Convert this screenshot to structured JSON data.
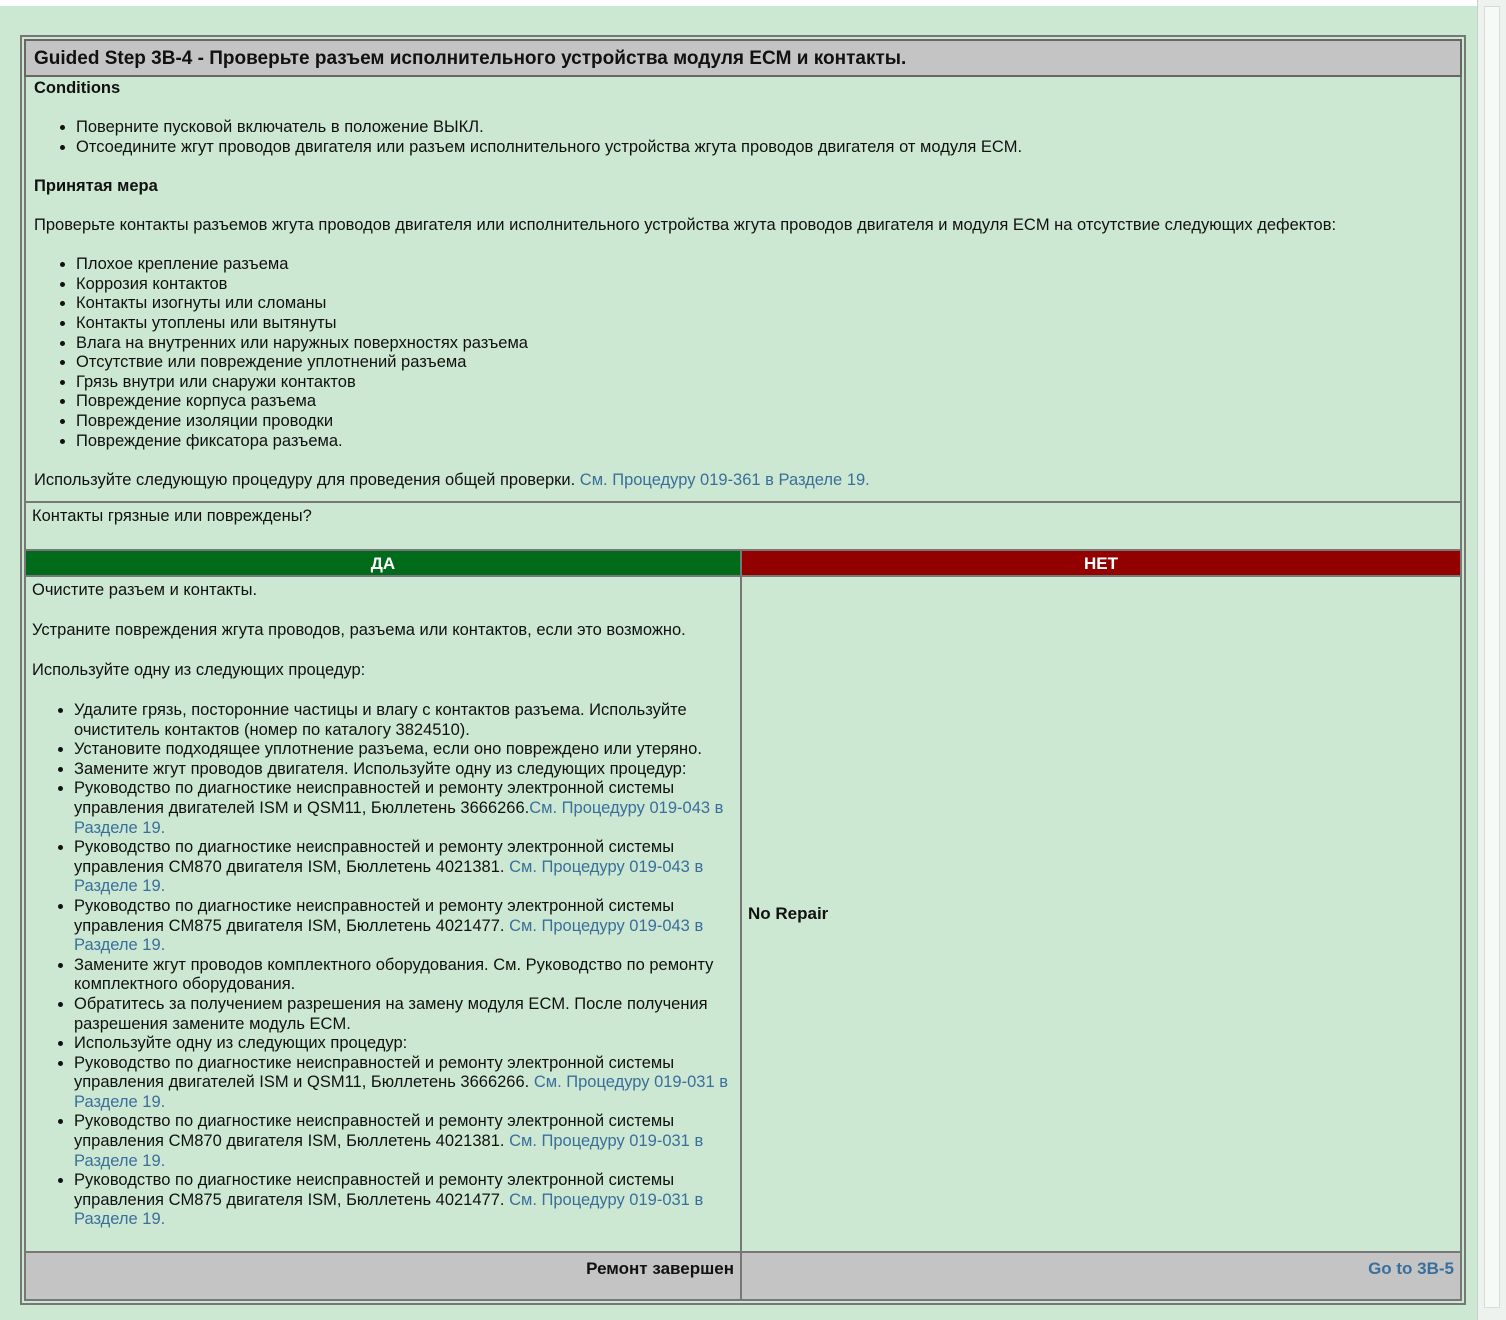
{
  "step": {
    "title": "Guided Step 3B-4 - Проверьте разъем исполнительного устройства модуля ECM и контакты."
  },
  "conditions": {
    "heading": "Conditions",
    "items": [
      "Поверните пусковой включатель в положение ВЫКЛ.",
      "Отсоедините жгут проводов двигателя или разъем исполнительного устройства жгута проводов двигателя от модуля ECM."
    ],
    "action_heading": "Принятая мера",
    "action_text": "Проверьте контакты разъемов жгута проводов двигателя или исполнительного устройства жгута проводов двигателя и модуля ECM на отсутствие следующих дефектов:",
    "defects": [
      "Плохое крепление разъема",
      "Коррозия контактов",
      "Контакты изогнуты или сломаны",
      "Контакты утоплены или вытянуты",
      "Влага на внутренних или наружных поверхностях разъема",
      "Отсутствие или повреждение уплотнений разъема",
      "Грязь внутри или снаружи контактов",
      "Повреждение корпуса разъема",
      "Повреждение изоляции проводки",
      "Повреждение фиксатора разъема."
    ],
    "procedure_text": "Используйте следующую процедуру для проведения общей проверки. ",
    "procedure_link": "См. Процедуру 019-361 в Разделе 19."
  },
  "question": "Контакты грязные или повреждены?",
  "yes": {
    "header": "ДА",
    "p1": "Очистите разъем и контакты.",
    "p2": "Устраните повреждения жгута проводов, разъема или контактов, если это возможно.",
    "p3": "Используйте одну из следующих процедур:",
    "items": [
      {
        "text": "Удалите грязь, посторонние частицы и влагу с контактов разъема. Используйте очиститель контактов (номер по каталогу 3824510).",
        "link": ""
      },
      {
        "text": "Установите подходящее уплотнение разъема, если оно повреждено или утеряно.",
        "link": ""
      },
      {
        "text": "Замените жгут проводов двигателя. Используйте одну из следующих процедур:",
        "link": ""
      },
      {
        "text": "Руководство по диагностике неисправностей и ремонту электронной системы управления двигателей ISM и QSM11, Бюллетень 3666266.",
        "link": "См. Процедуру 019-043 в Разделе 19."
      },
      {
        "text": "Руководство по диагностике неисправностей и ремонту электронной системы управления CM870 двигателя ISM, Бюллетень 4021381. ",
        "link": "См. Процедуру 019-043 в Разделе 19."
      },
      {
        "text": "Руководство по диагностике неисправностей и ремонту электронной системы управления CM875 двигателя ISM, Бюллетень 4021477. ",
        "link": "См. Процедуру 019-043 в Разделе 19."
      },
      {
        "text": "Замените жгут проводов комплектного оборудования. См. Руководство по ремонту комплектного оборудования.",
        "link": ""
      },
      {
        "text": "Обратитесь за получением разрешения на замену модуля ECM. После получения разрешения замените модуль ECM.",
        "link": ""
      },
      {
        "text": "Используйте одну из следующих процедур:",
        "link": ""
      },
      {
        "text": "Руководство по диагностике неисправностей и ремонту электронной системы управления двигателей ISM и QSM11, Бюллетень 3666266. ",
        "link": "См. Процедуру 019-031 в Разделе 19."
      },
      {
        "text": "Руководство по диагностике неисправностей и ремонту электронной системы управления CM870 двигателя ISM, Бюллетень 4021381. ",
        "link": "См. Процедуру 019-031 в Разделе 19."
      },
      {
        "text": "Руководство по диагностике неисправностей и ремонту электронной системы управления CM875 двигателя ISM, Бюллетень 4021477. ",
        "link": "См. Процедуру 019-031 в Разделе 19."
      }
    ],
    "footer": "Ремонт завершен"
  },
  "no": {
    "header": "НЕТ",
    "body": "No Repair",
    "footer_link": "Go to 3B-5"
  },
  "colors": {
    "background": "#cde8d2",
    "yes_header": "#006b1a",
    "no_header": "#920000",
    "link": "#3a6f9c",
    "title_bar": "#c4c4c4"
  }
}
